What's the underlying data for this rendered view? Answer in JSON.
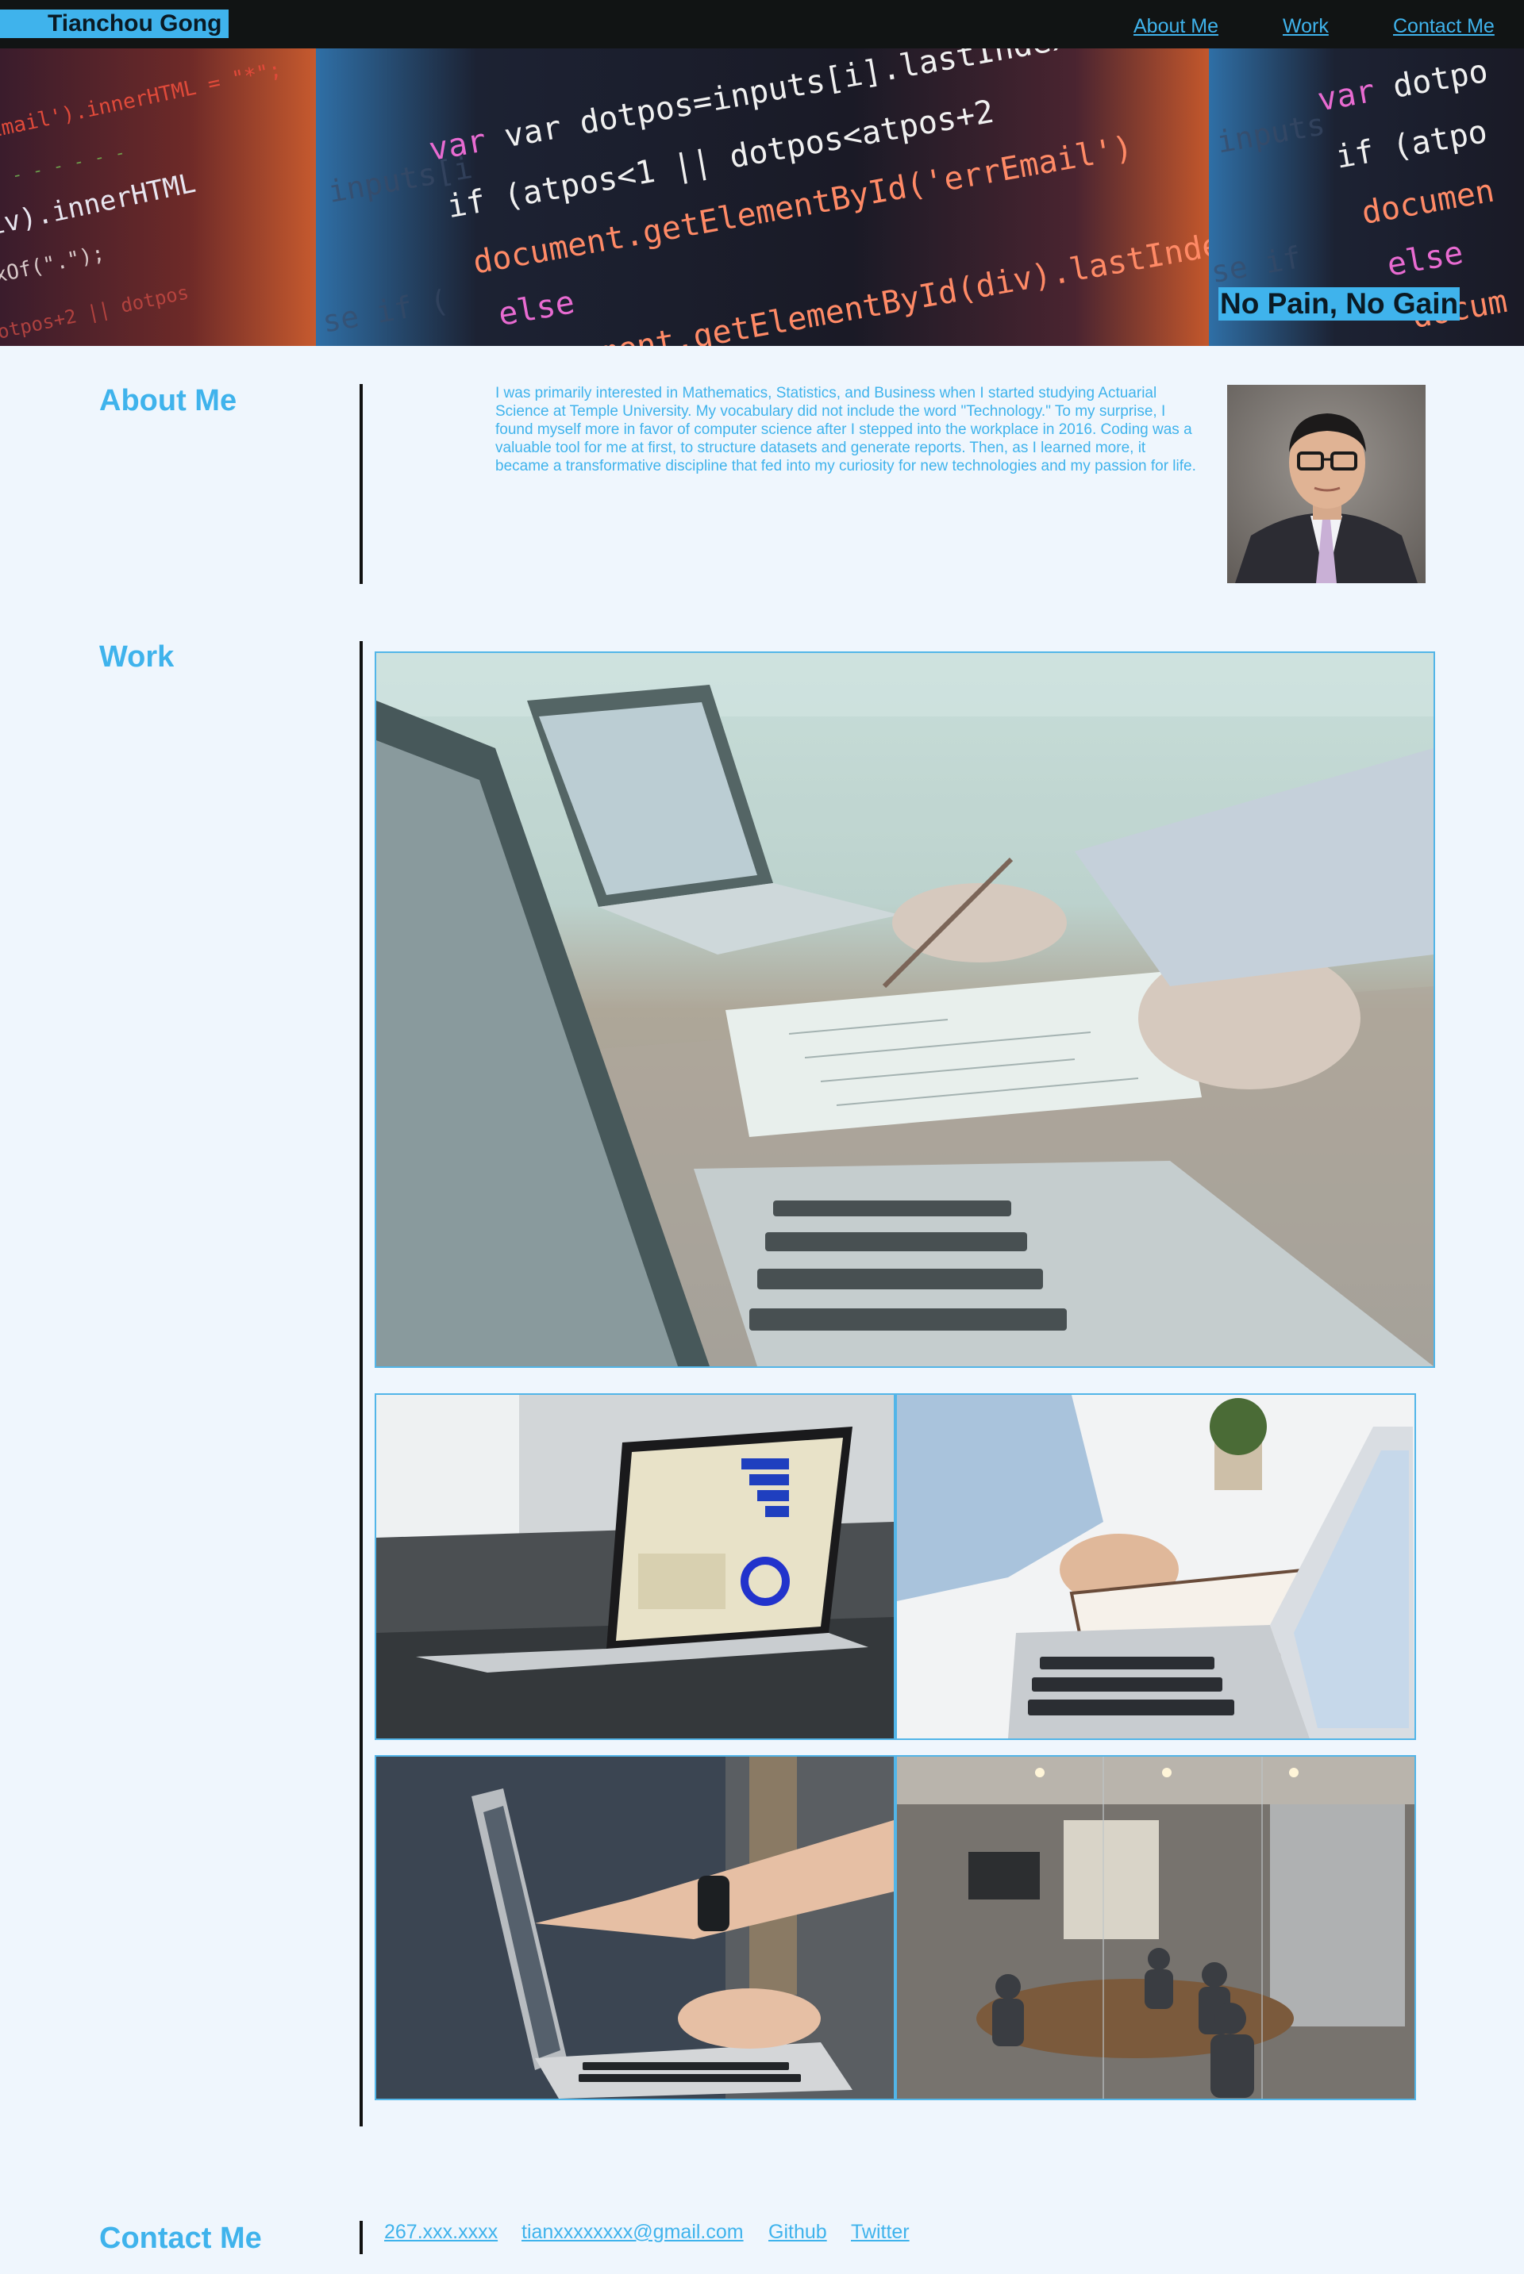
{
  "navbar": {
    "brand": "Tianchou Gong",
    "links": [
      "About Me",
      "Work",
      "Contact Me"
    ]
  },
  "hero": {
    "tagline": "No Pain, No Gain",
    "code_lines": [
      "var dotpos=inputs[i].lastIndexOf",
      "if (atpos<1 || dotpos<atpos+2",
      "document.getElementById('errEmail')",
      "else",
      "document.getElementById(div).lastIndexOf"
    ]
  },
  "about": {
    "title": "About Me",
    "text": "I was primarily interested in Mathematics, Statistics, and Business when I started studying Actuarial Science at Temple University. My vocabulary did not include the word \"Technology.\" To my surprise, I found myself more in favor of computer science after I stepped into the workplace in 2016. Coding was a valuable tool for me at first, to structure datasets and generate reports. Then, as I learned more, it became a transformative discipline that fed into my curiosity for new technologies and my passion for life."
  },
  "work": {
    "title": "Work"
  },
  "contact": {
    "title": "Contact Me",
    "links": [
      "267.xxx.xxxx",
      "tianxxxxxxxx@gmail.com",
      "Github",
      "Twitter"
    ]
  },
  "colors": {
    "accent": "#3fb3ec",
    "navbar_bg": "#111414",
    "page_bg": "#eff6fd",
    "frame_border": "#52b5e8"
  }
}
